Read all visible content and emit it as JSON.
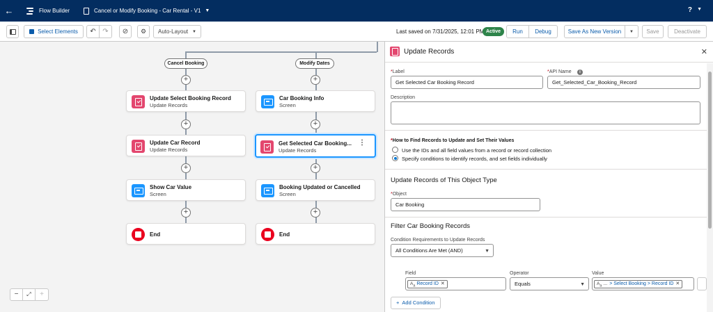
{
  "header": {
    "app_title": "Flow Builder",
    "flow_name": "Cancel or Modify Booking - Car Rental - V1",
    "help": "?"
  },
  "toolbar": {
    "select_elements": "Select Elements",
    "layout": "Auto-Layout",
    "last_saved": "Last saved on 7/31/2025, 12:01 PM",
    "status": "Active",
    "run": "Run",
    "debug": "Debug",
    "save_as": "Save As New Version",
    "save": "Save",
    "deactivate": "Deactivate"
  },
  "canvas": {
    "branches": [
      {
        "label": "Cancel Booking",
        "nodes": [
          {
            "title": "Update Select Booking Record",
            "subtitle": "Update Records",
            "kind": "update"
          },
          {
            "title": "Update Car Record",
            "subtitle": "Update Records",
            "kind": "update"
          },
          {
            "title": "Show Car Value",
            "subtitle": "Screen",
            "kind": "screen"
          },
          {
            "title": "End",
            "subtitle": "",
            "kind": "end"
          }
        ]
      },
      {
        "label": "Modify Dates",
        "nodes": [
          {
            "title": "Car Booking Info",
            "subtitle": "Screen",
            "kind": "screen"
          },
          {
            "title": "Get Selected Car Booking...",
            "subtitle": "Update Records",
            "kind": "update",
            "selected": true
          },
          {
            "title": "Booking Updated or Cancelled",
            "subtitle": "Screen",
            "kind": "screen"
          },
          {
            "title": "End",
            "subtitle": "",
            "kind": "end"
          }
        ]
      }
    ]
  },
  "panel": {
    "title": "Update Records",
    "label_label": "Label",
    "label_value": "Get Selected Car Booking Record",
    "api_label": "API Name",
    "api_value": "Get_Selected_Car_Booking_Record",
    "description_label": "Description",
    "how_label": "How to Find Records to Update and Set Their Values",
    "option1": "Use the IDs and all field values from a record or record collection",
    "option2": "Specify conditions to identify records, and set fields individually",
    "object_section": "Update Records of This Object Type",
    "object_label": "Object",
    "object_value": "Car Booking",
    "filter_section": "Filter Car Booking Records",
    "cond_req_label": "Condition Requirements to Update Records",
    "cond_req_value": "All Conditions Are Met (AND)",
    "field_label": "Field",
    "operator_label": "Operator",
    "value_label": "Value",
    "field_token": "Record ID",
    "operator_value": "Equals",
    "value_prefix": "...",
    "value_token": "> Select Booking > Record ID",
    "add_condition": "Add Condition"
  },
  "colors": {
    "header_bg": "#032d60",
    "brand_blue": "#0176d3",
    "active_green": "#2e844a",
    "update_icon": "#e3466e",
    "screen_icon": "#1b96ff",
    "end_icon": "#ea001e"
  }
}
